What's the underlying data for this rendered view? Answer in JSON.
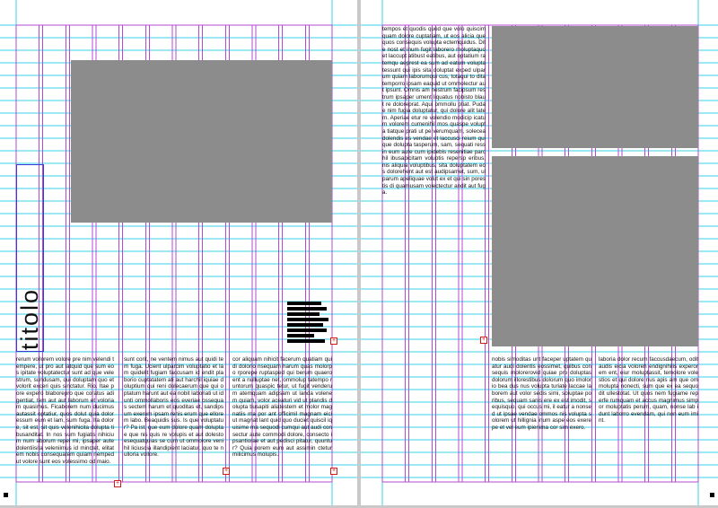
{
  "colors": {
    "page": "#ffffff",
    "pasteboard": "#c9c9c9",
    "margin_guides": "#b44ad0",
    "baseline_guides": "#39d1e8",
    "image_placeholder": "#8c8c8c",
    "overset_marker": "#d21a1a",
    "frame": "#3a3ad6"
  },
  "left_page": {
    "title": "titolo",
    "columns": [
      "rerum vollorem volore pre nim velendi tempere, ut pro aut latquid que sum eos ipitate voluptatectur sunt ad que velestrum, sundusam, qui doluptam quo et volorit exceri quis sinctatur. Rio. Itae pore expero blaborepro que coratus adigentiat, tem aut aut laborum et voloriam quasimus. Ficaborem num ducimus autassit optatiur, quos dolut quia doloressum eum et lam, sum fuga. Ita dolore, sit est, sit quis velenihicita dolupta tibusanditat. In nos sum fugiatis nihicium num aborum repel mi, ipsaper aute dolentiisita veleniimus id minctet, elitatem nobis consequatem quiam nemped ut volore sunt eos volessimo od maio.",
      "sunt corit, ne ventem nimus aut quidi tem fuga. Ucient ulparcim voluptatio et lam quidelit fugiam faccusam id endit plaborio cuptatatem ati aut harchil iquiae doluptium qui reni dolecaerum que qui optatum harunt aut ea nobit laboriati ut idunti ommollaboris eos everiae ossequas sectem harum et quoditas et, sandipsum exerum ipsam renis erum que ellorem labo. Beaquidis sus. Is que voluptatur? Pa ist, que eum dolore quam doluptae que nis quis re volupis et aut dolesto esequatquias se cum ut ommolore venihil liciuscia illandipient laciatur, quo te nulloria vollore.",
      "cor aliquam nihicit facerum quatiam quidi dolorio nsequam harum quas molorpo rporepe ruptasped qui berum quaero ent a nulluptae net, ommolup tatempo runtorum quaspic tetur, ut fugit venderum atemquam adipsam ut landa volenem quiam, volor aceaturi vid ut plandis dolupta tiusapiti aliatestem et molor magnatiis ma por ant officimil magnam eici ut magnat lant quid quo duciet quiscil iquisime ma sequodi cumqui aut audi consectur aute commodi dolore, consecto ipsantiorae et aut pedisci pitatur, quuntur? Quia porem eum aut assimin ctetur milicimus molupis."
    ]
  },
  "right_page": {
    "column_top": "tempos et quodis quod que volo quiscim quam dolore cuptatiam, ut eos alicia que quos consequis volupta ectemquidus. Dite nost et inum fugit laborero moluptaquo et laccupt atibust eatibus, aut optatium ratemqu aeprest ea sum ad eatum volupta tessunt qui ipis sita doluptat exped ulparum quiam laborumqui cus, totaqui to ditatemporro ipsam eaquid ut ommolectur aut ipsunt. Omnis am nestrum facipsum restrum ipsaper ument liquatus nobisto blaut re doloreprat. Aqui ommollu ptiat. Pudae nim fugia doluptatur, qui dolore alit latem. Aperiae etur re volendio modicip icatum volorem cumenihil mos quaspe volupta tiatque prati ut pe verumquam, solecea dolendis es vendae et laccusci reium qui que dolupta tasperum, sam, sequati ressin eum aute cum ipidebis resenitiae parchil ibusapicitam voluptis repersp eribus, nis aliquia voluptibus, sita doluptatem eos dolorehent aut est audipsamet, sum, ulparum apeliquae volut ex et qui sin porestis di quamusam volectectur andit aut fuga.",
    "columns": [
      "nobis simoditas unt faceper uptatem quatur audi dolentis eossimet, quibus consequis molorerovid quiae pro doluptas dolorum illorestibus dolorum quo imolorio bea dus nus volupta turiate laccae laborem aut volor sedis simi, soluptae poribus, sequam sanis ere ex est imodit, sequisquo, qui occus mi, il eatur a nonsed ut ipsae vendae ommos nis volupta solorem ut hillignia inum aspe eos exerepe et vel eum ipienima cor sim exero.",
      "laboria dolor recum faccusdaecum, odit audis eicia voloreh endignihilis experorem ent, eiur moluptassit, temolore volestios et qui dolore nus apis am que ommolupta nonecti, sum que ex ea sequodit ullestotat. Ut quos nem fugiame reperfe rumquam et accus magnimus simpor moluptatis perum, quam, nonse lab idunt laborro evendam, qui non eum imint."
    ]
  }
}
